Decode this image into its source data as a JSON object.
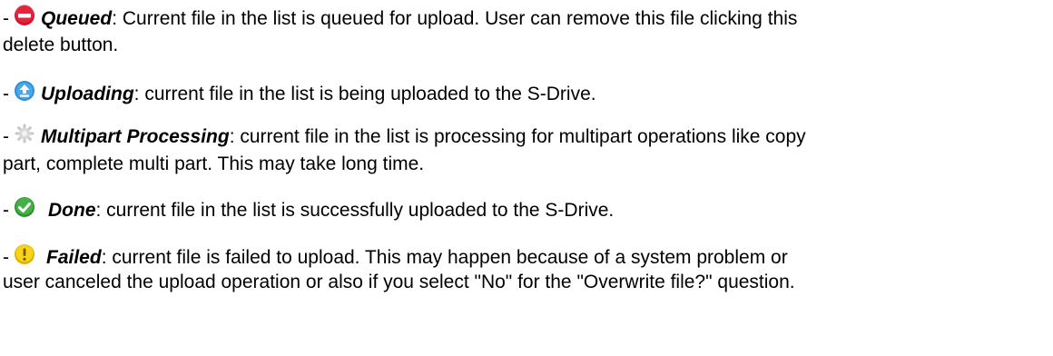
{
  "items": [
    {
      "dash": "-",
      "icon": "delete-minus-icon",
      "status": "Queued",
      "text": ": Current file in the list is queued for upload. User can remove this file clicking this",
      "text_cont": "delete button."
    },
    {
      "dash": "-",
      "icon": "upload-arrow-icon",
      "status": "Uploading",
      "text": ": current file in the list is being uploaded to the S-Drive."
    },
    {
      "dash": "-",
      "icon": "gear-processing-icon",
      "status": "Multipart Processing",
      "text": ": current file in the list is processing for multipart operations like copy",
      "text_cont": "part, complete multi part. This may take long time."
    },
    {
      "dash": "-",
      "icon": "checkmark-done-icon",
      "status": "Done",
      "text": ": current file in the list is successfully uploaded to the S-Drive."
    },
    {
      "dash": "-",
      "icon": "exclamation-warning-icon",
      "status": "Failed",
      "text": ": current file is failed to upload. This may happen because of a system problem or",
      "text_cont": "user canceled the upload operation or also if you select \"No\" for the \"Overwrite file?\" question."
    }
  ],
  "colors": {
    "queued": "#d8102b",
    "uploading": "#2e8fd4",
    "processing": "#c8c8c8",
    "done": "#3aa33a",
    "failed": "#f2c80f"
  }
}
